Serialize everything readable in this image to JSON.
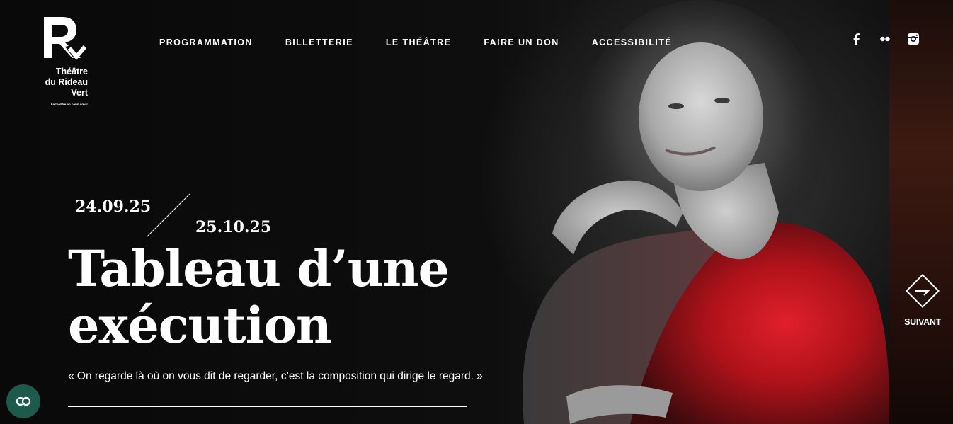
{
  "brand": {
    "name": "Théâtre\ndu Rideau\nVert",
    "tagline": "Le théâtre en plein cœur"
  },
  "nav": {
    "items": [
      {
        "label": "PROGRAMMATION"
      },
      {
        "label": "BILLETTERIE"
      },
      {
        "label": "LE THÉÂTRE"
      },
      {
        "label": "FAIRE UN DON"
      },
      {
        "label": "ACCESSIBILITÉ"
      }
    ]
  },
  "social": {
    "icons": [
      "facebook-icon",
      "flickr-icon",
      "instagram-icon"
    ]
  },
  "hero": {
    "date_start": "24.09.25",
    "date_end": "25.10.25",
    "title": "Tableau d’une exécution",
    "quote": "« On regarde là où on vous dit de regarder, c’est la composition qui dirige le regard. »"
  },
  "next": {
    "label": "SUIVANT"
  },
  "colors": {
    "background": "#0b0b0b",
    "accent_red": "#d0141e",
    "accessibility_button": "#1e5a4c"
  }
}
